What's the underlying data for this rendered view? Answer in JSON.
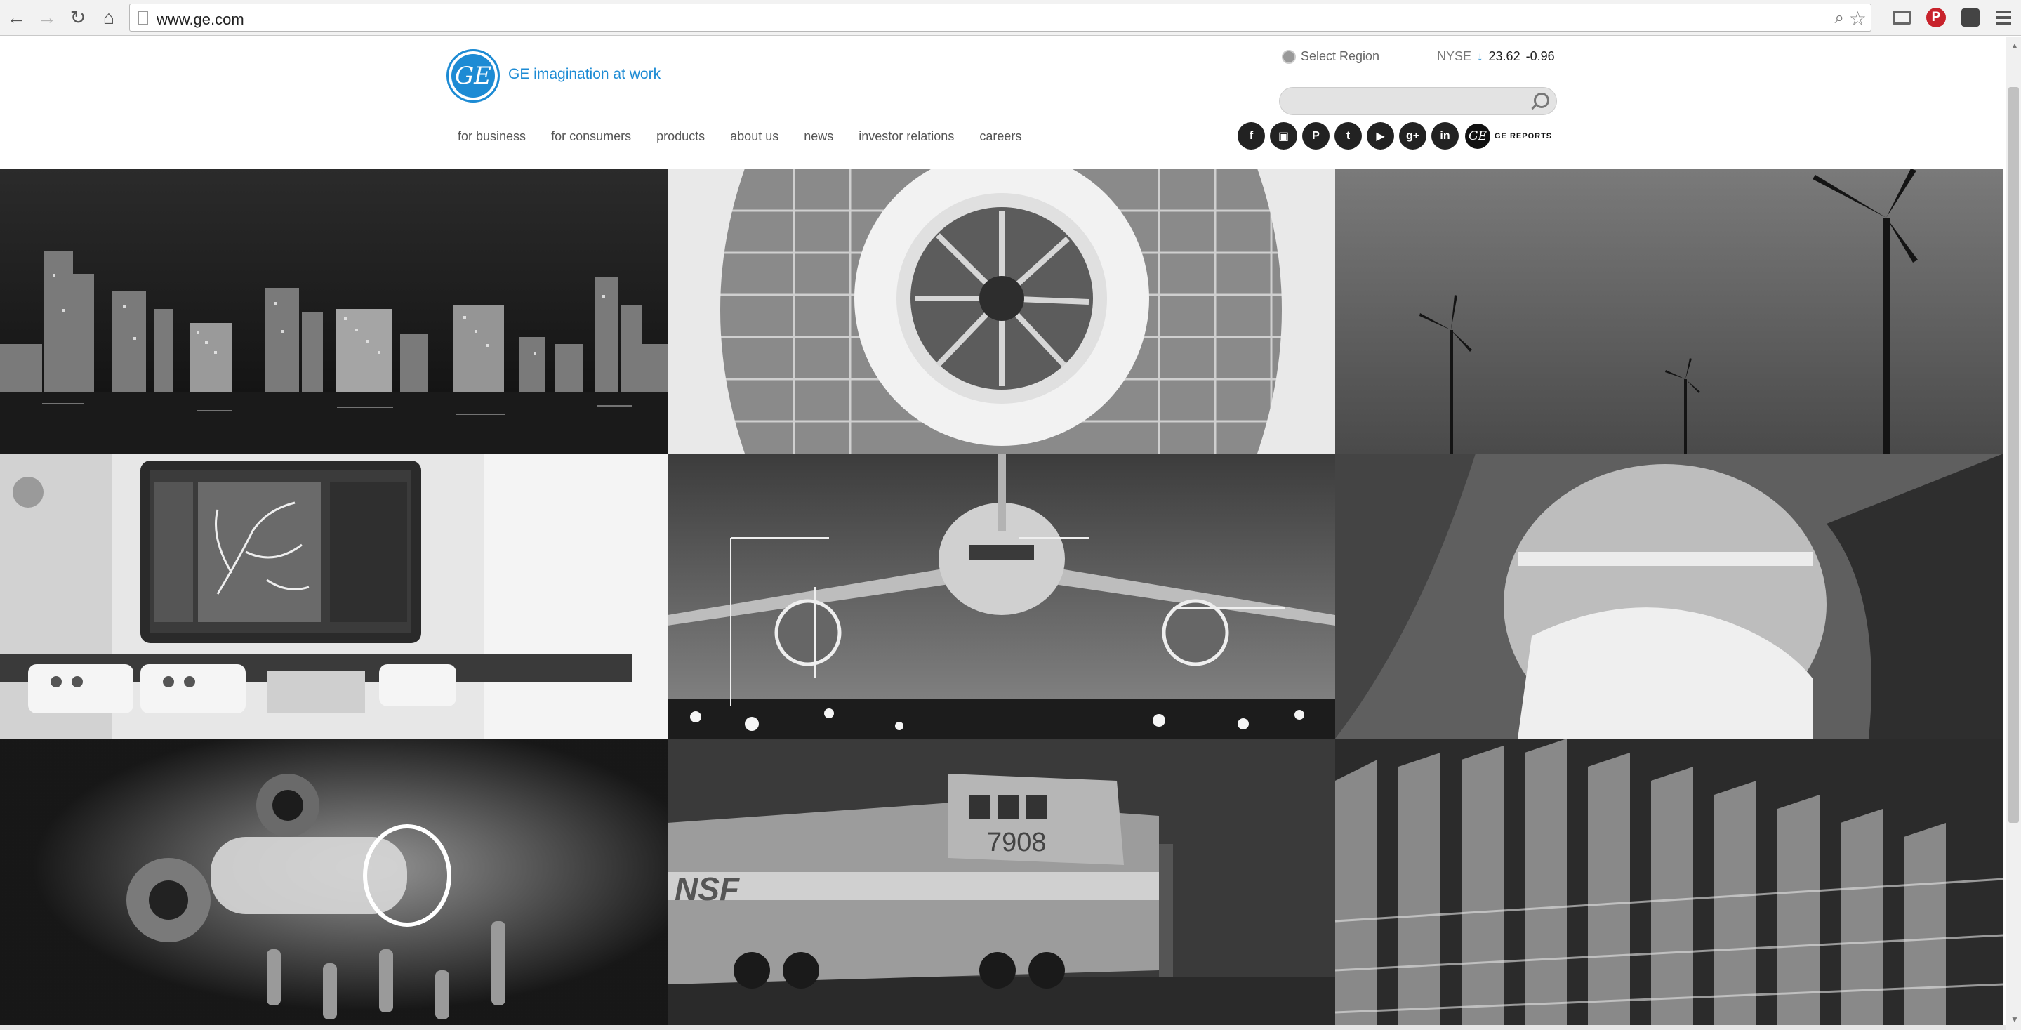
{
  "browser": {
    "url": "www.ge.com",
    "back_icon": "arrow-left-icon",
    "forward_icon": "arrow-right-icon",
    "reload_icon": "reload-icon",
    "home_icon": "home-icon",
    "pinterest_label": "P"
  },
  "header": {
    "logo_text": "GE",
    "tagline": "GE imagination at work",
    "region_label": "Select Region",
    "stock": {
      "exchange": "NYSE",
      "arrow": "↓",
      "price": "23.62",
      "change": "-0.96"
    },
    "search_placeholder": "",
    "nav": [
      "for business",
      "for consumers",
      "products",
      "about us",
      "news",
      "investor relations",
      "careers"
    ],
    "social": [
      {
        "name": "facebook-icon",
        "glyph": "f"
      },
      {
        "name": "instagram-icon",
        "glyph": "▣"
      },
      {
        "name": "pinterest-icon",
        "glyph": "P"
      },
      {
        "name": "twitter-icon",
        "glyph": "t"
      },
      {
        "name": "youtube-icon",
        "glyph": "▶"
      },
      {
        "name": "googleplus-icon",
        "glyph": "g+"
      },
      {
        "name": "linkedin-icon",
        "glyph": "in"
      }
    ],
    "ge_reports_mark": "GE",
    "ge_reports_label": "GE REPORTS"
  },
  "tiles": [
    {
      "name": "tile-city-skyline-night"
    },
    {
      "name": "tile-jet-engine"
    },
    {
      "name": "tile-wind-turbines"
    },
    {
      "name": "tile-medical-imaging-monitor"
    },
    {
      "name": "tile-airliner-landing"
    },
    {
      "name": "tile-pipe-snow-landscape"
    },
    {
      "name": "tile-glowing-tubes"
    },
    {
      "name": "tile-locomotive",
      "number_text": "7908",
      "side_text": "NSF"
    },
    {
      "name": "tile-turbine-blades"
    }
  ]
}
